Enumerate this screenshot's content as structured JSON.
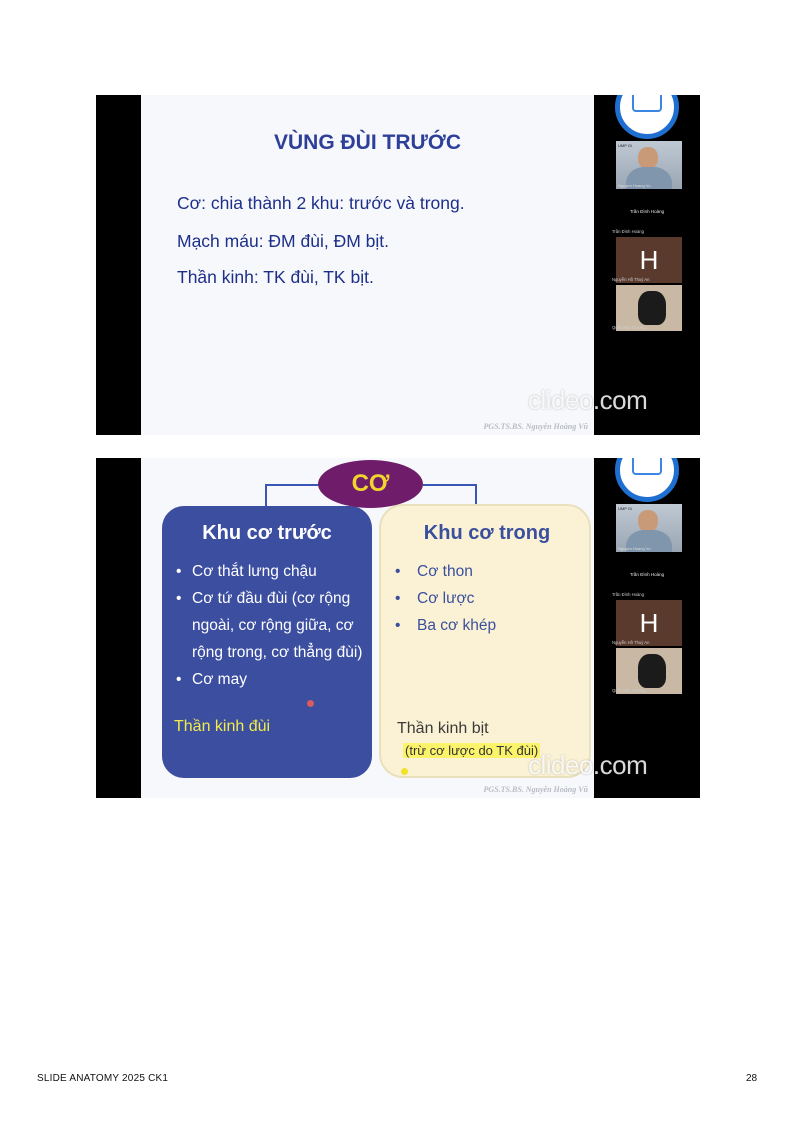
{
  "slide1": {
    "title": "VÙNG ĐÙI TRƯỚC",
    "lines": [
      "Cơ: chia thành 2 khu: trước và trong.",
      "Mạch máu: ĐM đùi, ĐM bịt.",
      "Thần kinh: TK đùi, TK bịt."
    ],
    "signature": "PGS.TS.BS. Nguyễn Hoàng Vũ",
    "watermark": "clideo.com"
  },
  "slide2": {
    "center_label": "CƠ",
    "left_box": {
      "title": "Khu cơ trước",
      "items": [
        "Cơ thắt lưng chậu",
        "Cơ tứ đầu đùi (cơ rộng ngoài, cơ rộng giữa, cơ rộng trong, cơ thẳng đùi)",
        "Cơ may"
      ],
      "nerve": "Thần kinh đùi"
    },
    "right_box": {
      "title": "Khu cơ trong",
      "items": [
        "Cơ thon",
        "Cơ lược",
        "Ba cơ khép"
      ],
      "nerve": "Thần kinh bịt",
      "note": "(trừ cơ lược do TK đùi)"
    },
    "signature": "PGS.TS.BS. Nguyễn Hoàng Vũ",
    "watermark": "clideo.com"
  },
  "video_panel": {
    "host_label": "UMP Gi",
    "host_name": "Nguyen Hoang Vu",
    "center_name": "Trần Đình Hoàng",
    "tile_name": "Trần Đình Hoàng",
    "avatar_letter": "H",
    "avatar_name": "Nguyễn Hồ Thuỳ An",
    "cat_name": "Quốc Bảo Trương"
  },
  "footer": {
    "left": "SLIDE ANATOMY 2025 CK1",
    "page_number": "28"
  },
  "colors": {
    "title_blue": "#2e3f9a",
    "left_box": "#3c4ea0",
    "right_box": "#fbf2d5",
    "pill": "#6f1d6a",
    "pill_text": "#f2d42b",
    "nerve_yellow": "#f1ec4c"
  }
}
